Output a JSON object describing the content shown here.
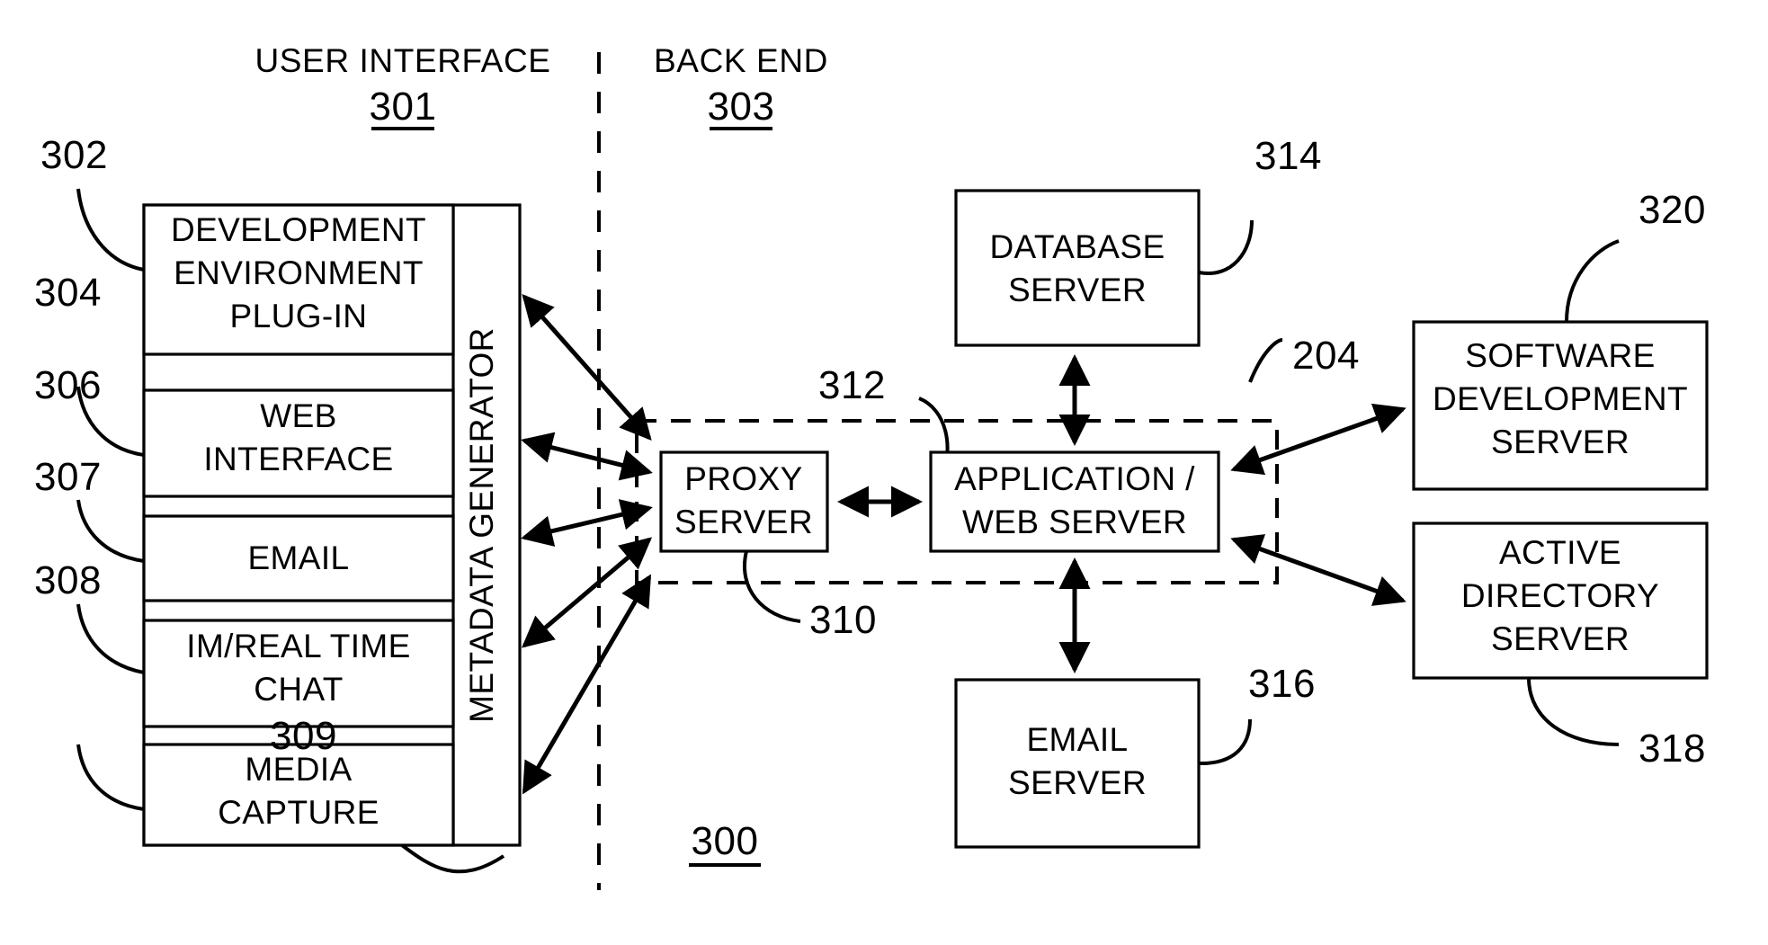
{
  "figure": {
    "figure_number": "300",
    "headers": [
      {
        "title": "USER INTERFACE",
        "ref": "301"
      },
      {
        "title": "BACK END",
        "ref": "303"
      }
    ],
    "ui_components": [
      {
        "ref": "302",
        "lines": [
          "DEVELOPMENT",
          "ENVIRONMENT",
          "PLUG-IN"
        ]
      },
      {
        "ref": "304",
        "lines": [
          "WEB",
          "INTERFACE"
        ]
      },
      {
        "ref": "306",
        "lines": [
          "EMAIL"
        ]
      },
      {
        "ref": "307",
        "lines": [
          "IM/REAL TIME",
          "CHAT"
        ]
      },
      {
        "ref": "308",
        "lines": [
          "MEDIA",
          "CAPTURE"
        ]
      }
    ],
    "metadata_generator": {
      "ref": "309",
      "label": "METADATA GENERATOR"
    },
    "backend_group": {
      "ref": "310"
    },
    "proxy_server": {
      "ref": "312",
      "lines": [
        "PROXY",
        "SERVER"
      ]
    },
    "application_web_server": {
      "ref": "204",
      "lines": [
        "APPLICATION /",
        "WEB SERVER"
      ]
    },
    "database_server": {
      "ref": "314",
      "lines": [
        "DATABASE",
        "SERVER"
      ]
    },
    "email_server": {
      "ref": "316",
      "lines": [
        "EMAIL",
        "SERVER"
      ]
    },
    "software_development_server": {
      "ref": "320",
      "lines": [
        "SOFTWARE",
        "DEVELOPMENT",
        "SERVER"
      ]
    },
    "active_directory_server": {
      "ref": "318",
      "lines": [
        "ACTIVE",
        "DIRECTORY",
        "SERVER"
      ]
    },
    "colors": {
      "ink": "#000000",
      "paper": "#ffffff"
    }
  }
}
